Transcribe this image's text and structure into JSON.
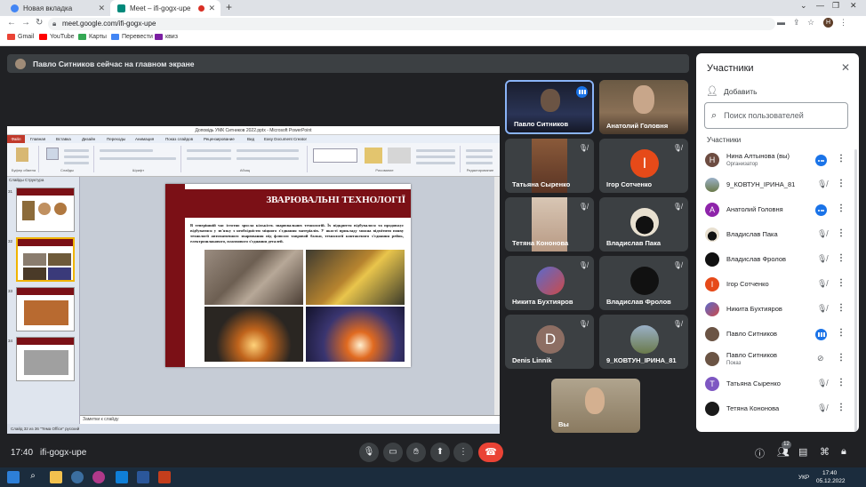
{
  "browser": {
    "tabs": [
      {
        "label": "Новая вкладка"
      },
      {
        "label": "Meet – ifi-gogx-upe"
      }
    ],
    "new_tab": "+",
    "url": "meet.google.com/ifi-gogx-upe",
    "bookmarks": [
      "Gmail",
      "YouTube",
      "Карты",
      "Перевести",
      "квиз"
    ]
  },
  "meet": {
    "banner": "Павло Ситников сейчас на главном экране",
    "meeting_time": "17:40",
    "meeting_code": "ifi-gogx-upe"
  },
  "presentation": {
    "window_title": "Доповідь УМК Ситников 2022.pptx - Microsoft PowerPoint",
    "file_menu": "Файл",
    "menu_items": [
      "Главная",
      "Вставка",
      "Дизайн",
      "Переходы",
      "Анимация",
      "Показ слайдов",
      "Рецензирование",
      "Вид",
      "Easy Document Creator"
    ],
    "ribbon_groups": [
      "Буфер обмена",
      "Слайды",
      "Шрифт",
      "Абзац",
      "Рисование",
      "Редактирование"
    ],
    "thumb_tabs": "Слайды    Структура",
    "thumb_numbers": [
      "31",
      "32",
      "33",
      "34"
    ],
    "slide_title": "ЗВАРЮВАЛЬНІ ТЕХНОЛОГІЇ",
    "slide_body": "В теперішній час істотно зросла кількість зварювальних технологій. Їх відкриття відбувалося та продовжує відбуватися у зв'язку з необхідністю міцного з'єднання матеріалів. У якості прикладу можна відмітити появу технології автоматичного зварювання під флюсом тавровой балки, технології контактного з'єднання рейок, електрошлакового, плазмового з'єднання деталей.",
    "notes": "Заметки к слайду",
    "status": "Слайд 32 из 36    \"Тема Office\"    русский"
  },
  "tiles": [
    {
      "name": "Павло Ситников",
      "active": true
    },
    {
      "name": "Анатолий Головня"
    },
    {
      "name": "Татьяна Сыренко"
    },
    {
      "name": "Ігор Сотченко",
      "letter": "І"
    },
    {
      "name": "Тетяна Кононова"
    },
    {
      "name": "Владислав Пака"
    },
    {
      "name": "Никита Бухтияров"
    },
    {
      "name": "Владислав Фролов"
    },
    {
      "name": "Denis Linnik",
      "letter": "D"
    },
    {
      "name": "9_КОВТУН_ІРИНА_81"
    }
  ],
  "self_tile": {
    "name": "Вы"
  },
  "participants": {
    "title": "Участники",
    "add_label": "Добавить",
    "search_placeholder": "Поиск пользователей",
    "section": "Участники",
    "list": [
      {
        "name": "Нина Алтынова (вы)",
        "role": "Организатор",
        "letter": "Н",
        "color": "#6d4c41"
      },
      {
        "name": "9_КОВТУН_ІРИНА_81",
        "role": ""
      },
      {
        "name": "Анатолий Головня",
        "role": "",
        "letter": "А",
        "color": "#8e24aa"
      },
      {
        "name": "Владислав Пака",
        "role": ""
      },
      {
        "name": "Владислав Фролов",
        "role": ""
      },
      {
        "name": "Ігор Сотченко",
        "role": "",
        "letter": "І",
        "color": "#e64a19"
      },
      {
        "name": "Никита Бухтияров",
        "role": ""
      },
      {
        "name": "Павло Ситников",
        "role": ""
      },
      {
        "name": "Павло Ситников",
        "role": "Показ"
      },
      {
        "name": "Татьяна Сыренко",
        "role": "",
        "letter": "Т",
        "color": "#7e57c2"
      },
      {
        "name": "Тетяна Кононова",
        "role": ""
      }
    ]
  },
  "participants_count": "12",
  "taskbar": {
    "lang": "УКР",
    "time": "17:40",
    "date": "05.12.2022"
  },
  "colors": {
    "meet_bg": "#202124",
    "tile_bg": "#3c4043",
    "accent": "#1a73e8",
    "end_call": "#ea4335",
    "slide_red": "#7b1016"
  }
}
